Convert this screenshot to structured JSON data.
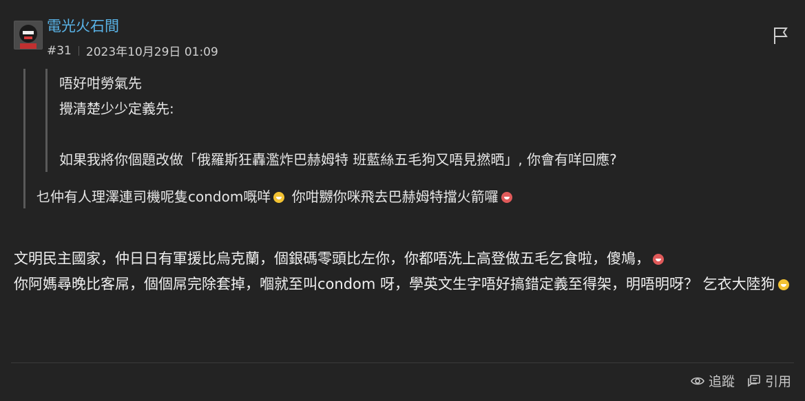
{
  "post": {
    "username": "電光火石間",
    "floor": "#31",
    "timestamp": "2023年10月29日 01:09"
  },
  "quote": {
    "inner_lines": [
      "唔好咁勞氣先",
      "攪清楚少少定義先:",
      "",
      "如果我將你個題改做「俄羅斯狂轟濫炸巴赫姆特 班藍絲五毛狗又唔見撚晒」, 你會有咩回應?"
    ],
    "outer_line_before": "乜仲有人理澤連司機呢隻condom嘅咩",
    "outer_line_after": "你咁嬲你咪飛去巴赫姆特擋火箭囉"
  },
  "body": {
    "para1": "文明民主國家，仲日日有軍援比烏克蘭，個銀碼零頭比左你，你都唔洗上高登做五毛乞食啦，傻鳩，",
    "para2": "你阿媽尋晚比客屌，個個屌完除套掉，嗰就至叫condom 呀，學英文生字唔好搞錯定義至得架，明唔明呀？ 乞衣大陸狗"
  },
  "actions": {
    "track_label": "追蹤",
    "quote_label": "引用"
  },
  "colors": {
    "background": "#232323",
    "username": "#5ab4e8",
    "text": "#e6e6e6"
  },
  "icons": [
    "avatar",
    "flag-icon",
    "laugh-emoji",
    "angry-emoji",
    "eye-icon",
    "quote-icon"
  ]
}
